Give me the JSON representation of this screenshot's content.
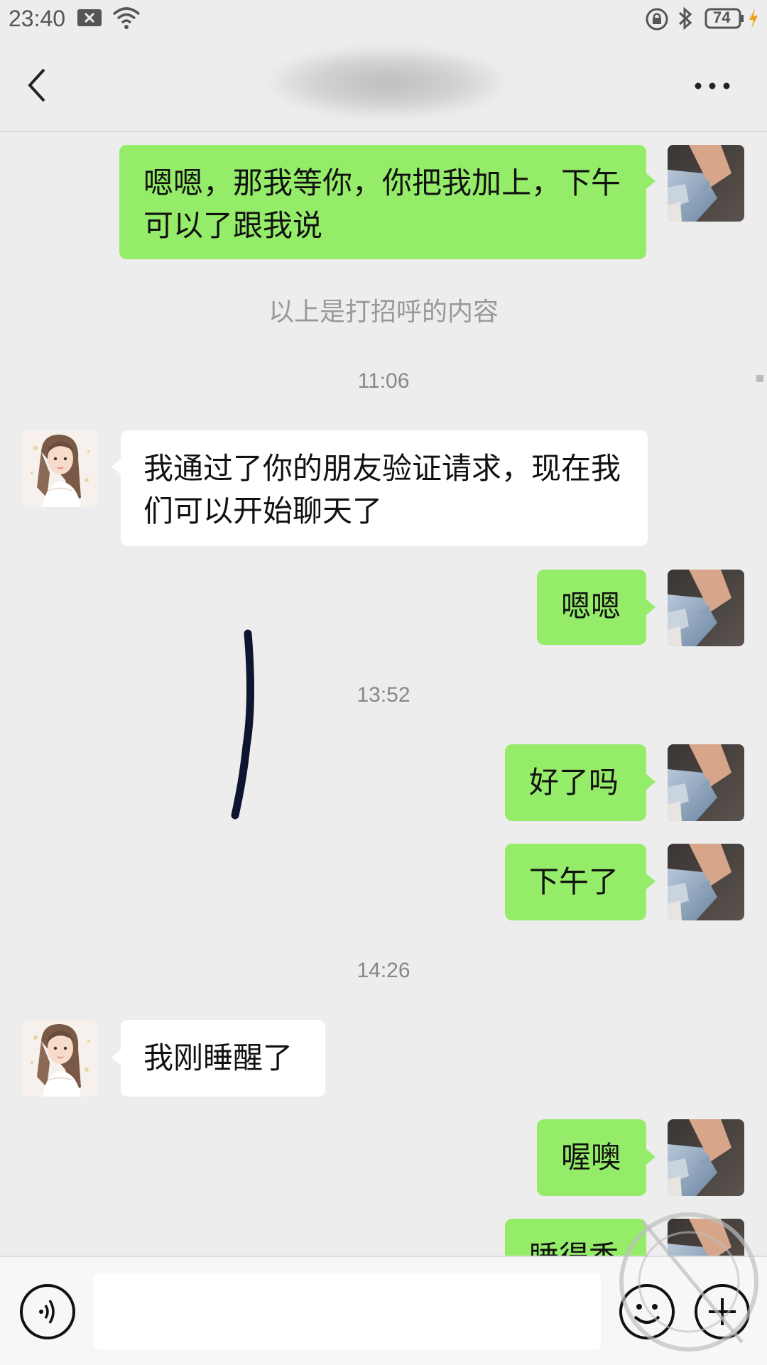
{
  "status_bar": {
    "time": "23:40",
    "battery": "74"
  },
  "header": {
    "title": ""
  },
  "messages": {
    "m1": "嗯嗯，那我等你，你把我加上，下午可以了跟我说",
    "system": "以上是打招呼的内容",
    "t1": "11:06",
    "m2": "我通过了你的朋友验证请求，现在我们可以开始聊天了",
    "m3": "嗯嗯",
    "t2": "13:52",
    "m4": "好了吗",
    "m5": "下午了",
    "t3": "14:26",
    "m6": "我刚睡醒了",
    "m7": "喔噢",
    "m8": "睡得香"
  },
  "input": {
    "placeholder": ""
  },
  "icons": {
    "status": [
      "notification-x-icon",
      "wifi-icon",
      "rotation-lock-icon",
      "bluetooth-icon",
      "battery-icon",
      "charging-icon"
    ],
    "nav": [
      "back-arrow-icon",
      "more-icon"
    ],
    "input": [
      "voice-icon",
      "emoji-icon",
      "plus-icon"
    ]
  },
  "colors": {
    "sent_bubble": "#95ec69",
    "received_bubble": "#ffffff",
    "background": "#ededed"
  }
}
